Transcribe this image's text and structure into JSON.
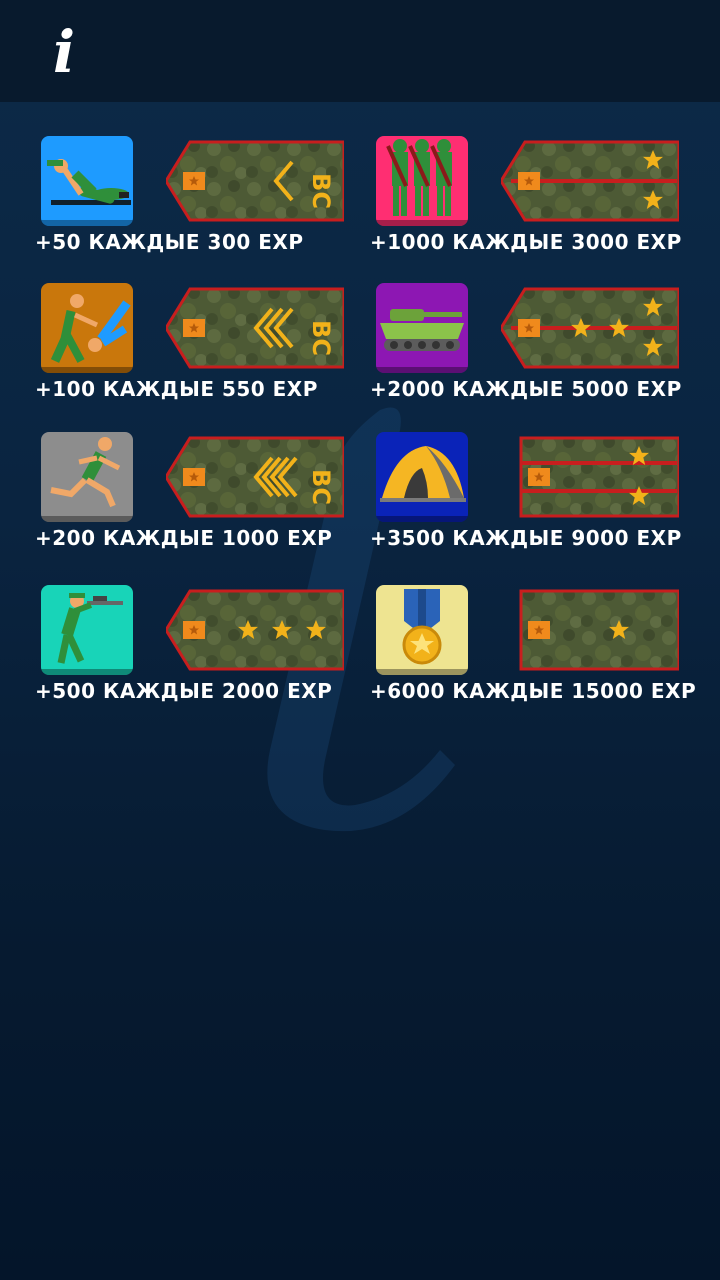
{
  "header": {
    "info_symbol": "i"
  },
  "rewards": [
    {
      "text": "+50 КАЖДЫЕ 300 EXP",
      "icon": "pushups-icon",
      "tile_color": "#1e9bff",
      "rank": "private-first-class-strap"
    },
    {
      "text": "+1000 КАЖДЫЕ 3000 EXP",
      "icon": "soldiers-parade-icon",
      "tile_color": "#ff2e72",
      "rank": "second-lieutenant-strap"
    },
    {
      "text": "+100 КАЖДЫЕ 550 EXP",
      "icon": "wrestling-icon",
      "tile_color": "#c9770c",
      "rank": "sergeant-strap"
    },
    {
      "text": "+2000 КАЖДЫЕ 5000 EXP",
      "icon": "tank-icon",
      "tile_color": "#8d17b3",
      "rank": "captain-strap"
    },
    {
      "text": "+200 КАЖДЫЕ 1000 EXP",
      "icon": "running-soldier-icon",
      "tile_color": "#8d8d8d",
      "rank": "senior-sergeant-strap"
    },
    {
      "text": "+3500 КАЖДЫЕ 9000 EXP",
      "icon": "tent-icon",
      "tile_color": "#0a23b8",
      "rank": "lieutenant-colonel-strap"
    },
    {
      "text": "+500 КАЖДЫЕ 2000 EXP",
      "icon": "sniper-icon",
      "tile_color": "#18d4b8",
      "rank": "senior-warrant-officer-strap"
    },
    {
      "text": "+6000 КАЖДЫЕ 15000 EXP",
      "icon": "medal-icon",
      "tile_color": "#eee491",
      "rank": "major-strap"
    }
  ],
  "colors": {
    "strap_camo_base": "#4d5a35",
    "strap_edge": "#c81e1e",
    "rank_gold": "#f2b21a",
    "button_orange": "#f08a1c"
  }
}
